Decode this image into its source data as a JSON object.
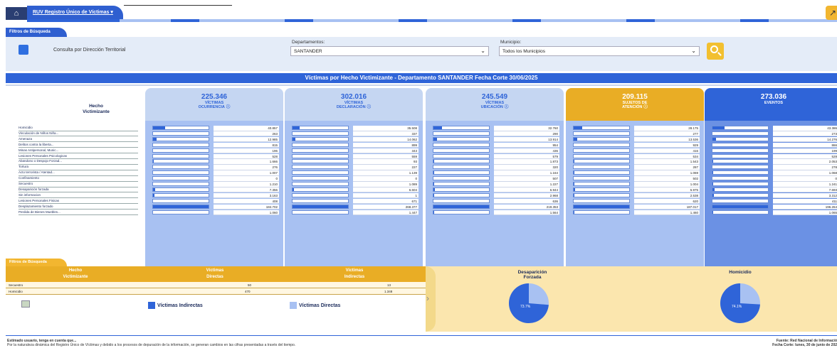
{
  "nav": {
    "home_icon": "home-icon",
    "tab_label": "RUV Registro Único de Víctimas",
    "tab_chevron": "▾",
    "export_icon": "export-icon"
  },
  "filters": {
    "tab_label": "Filtros de Búsqueda",
    "consulta_label": "Consulta por Dirección Territorial",
    "departamentos_label": "Departamentos:",
    "departamentos_value": "SANTANDER",
    "municipio_label": "Municipio:",
    "municipio_value": "Todos los Municipios",
    "search_icon": "search-icon"
  },
  "title": "Víctimas por Hecho Victimizante - Departamento SANTANDER   Fecha Corte 30/06/2025",
  "hecho_header": [
    "Hecho",
    "Victimizante"
  ],
  "rows": [
    "Homicidio",
    "Vinculación de Niños Niña...",
    "Amenaza",
    "Delitos contra la liberta...",
    "Minas Antipersonal, Munic...",
    "Lesiones Personales Psicologicas",
    "Abandono o Despojo Forzad...",
    "Tortura",
    "Acto terrorista / Atentad...",
    "Confinamiento",
    "Secuestro",
    "Desaparición forzada",
    "Sin informacion",
    "Lesiones Personales Fisicas",
    "Desplazamiento forzado",
    "Perdida de Bienes Muebles..."
  ],
  "columns": [
    {
      "total": "225.346",
      "label1": "VÍCTIMAS",
      "label2": "OCURRENCIA",
      "info_icon": "ⓘ",
      "values": [
        "40.857",
        "263",
        "12.985",
        "815",
        "196",
        "528",
        "1.666",
        "276",
        "1.007",
        "0",
        "1.210",
        "7.356",
        "3.163",
        "408",
        "184.702",
        "1.060"
      ],
      "fractions": [
        0.22,
        0.0,
        0.07,
        0.0,
        0.0,
        0.0,
        0.01,
        0.0,
        0.0,
        0.0,
        0.0,
        0.04,
        0.02,
        0.0,
        1.0,
        0.0
      ]
    },
    {
      "total": "302.016",
      "label1": "VÍCTIMAS",
      "label2": "DECLARACIÓN",
      "info_icon": "ⓘ",
      "values": [
        "35.508",
        "337",
        "14.062",
        "899",
        "343",
        "559",
        "93",
        "227",
        "1.139",
        "0",
        "1.089",
        "6.604",
        "1",
        "671",
        "268.377",
        "1.447"
      ],
      "fractions": [
        0.13,
        0.0,
        0.05,
        0.0,
        0.0,
        0.0,
        0.0,
        0.0,
        0.0,
        0.0,
        0.0,
        0.02,
        0.0,
        0.0,
        1.0,
        0.0
      ]
    },
    {
      "total": "245.549",
      "label1": "VÍCTIMAS",
      "label2": "UBICACIÓN",
      "info_icon": "ⓘ",
      "values": [
        "32.760",
        "290",
        "13.914",
        "954",
        "436",
        "579",
        "1.873",
        "320",
        "1.164",
        "507",
        "1.227",
        "6.944",
        "2.968",
        "636",
        "219.353",
        "1.564"
      ],
      "fractions": [
        0.15,
        0.0,
        0.06,
        0.0,
        0.0,
        0.0,
        0.01,
        0.0,
        0.01,
        0.0,
        0.01,
        0.03,
        0.01,
        0.0,
        1.0,
        0.01
      ]
    },
    {
      "total": "209.115",
      "label1": "SUJETOS DE",
      "label2": "ATENCIÓN",
      "info_icon": "ⓘ",
      "values": [
        "28.175",
        "277",
        "13.536",
        "929",
        "416",
        "534",
        "1.543",
        "287",
        "1.069",
        "502",
        "1.004",
        "5.975",
        "2.538",
        "620",
        "187.017",
        "1.460"
      ],
      "fractions": [
        0.15,
        0.0,
        0.07,
        0.0,
        0.0,
        0.0,
        0.01,
        0.0,
        0.01,
        0.0,
        0.01,
        0.03,
        0.01,
        0.0,
        1.0,
        0.01
      ]
    },
    {
      "total": "273.036",
      "label1": "EVENTOS",
      "label2": "",
      "info_icon": "ⓘ",
      "values": [
        "43.386",
        "273",
        "14.276",
        "866",
        "199",
        "528",
        "2.053",
        "278",
        "1.068",
        "0",
        "1.241",
        "7.693",
        "3.312",
        "411",
        "196.264",
        "1.065"
      ],
      "fractions": [
        0.22,
        0.0,
        0.07,
        0.0,
        0.0,
        0.0,
        0.01,
        0.0,
        0.01,
        0.0,
        0.01,
        0.04,
        0.02,
        0.0,
        1.0,
        0.01
      ]
    }
  ],
  "bottom": {
    "tab_label": "Filtros de Búsqueda",
    "head_hecho": [
      "Hecho",
      "Victimizante"
    ],
    "head_directas": [
      "Víctimas",
      "Directas"
    ],
    "head_indirectas": [
      "Víctimas",
      "Indirectas"
    ],
    "rows": [
      {
        "hecho": "Secuestro",
        "directas": "50",
        "indirectas": "13"
      },
      {
        "hecho": "Homicidio",
        "directas": "470",
        "indirectas": "1.348"
      }
    ],
    "legend_indirectas": "Víctimas Indirectas",
    "legend_directas": "Víctimas Directas",
    "chevron_icon": "›"
  },
  "pies": [
    {
      "title": [
        "Desaparición",
        "Forzada"
      ],
      "label": "73.7%",
      "share": 0.737
    },
    {
      "title": [
        "Homicidio",
        ""
      ],
      "label": "74.1%",
      "share": 0.741
    }
  ],
  "colors": {
    "primary": "#2f64d8",
    "accent": "#f2b630",
    "light": "#a8c1f2"
  },
  "footer": {
    "left1": "Estimado usuario, tenga en cuenta que...",
    "left2": "Por la naturaleza dinámica del Registro Único de Víctimas y debido a los procesos de depuración de la información, se generan cambios en las cifras presentadas a través del tiempo.",
    "right1": "Fuente: Red Nacional de Informació",
    "right2": "Fecha Corte: lunes, 30 de junio de 202"
  }
}
